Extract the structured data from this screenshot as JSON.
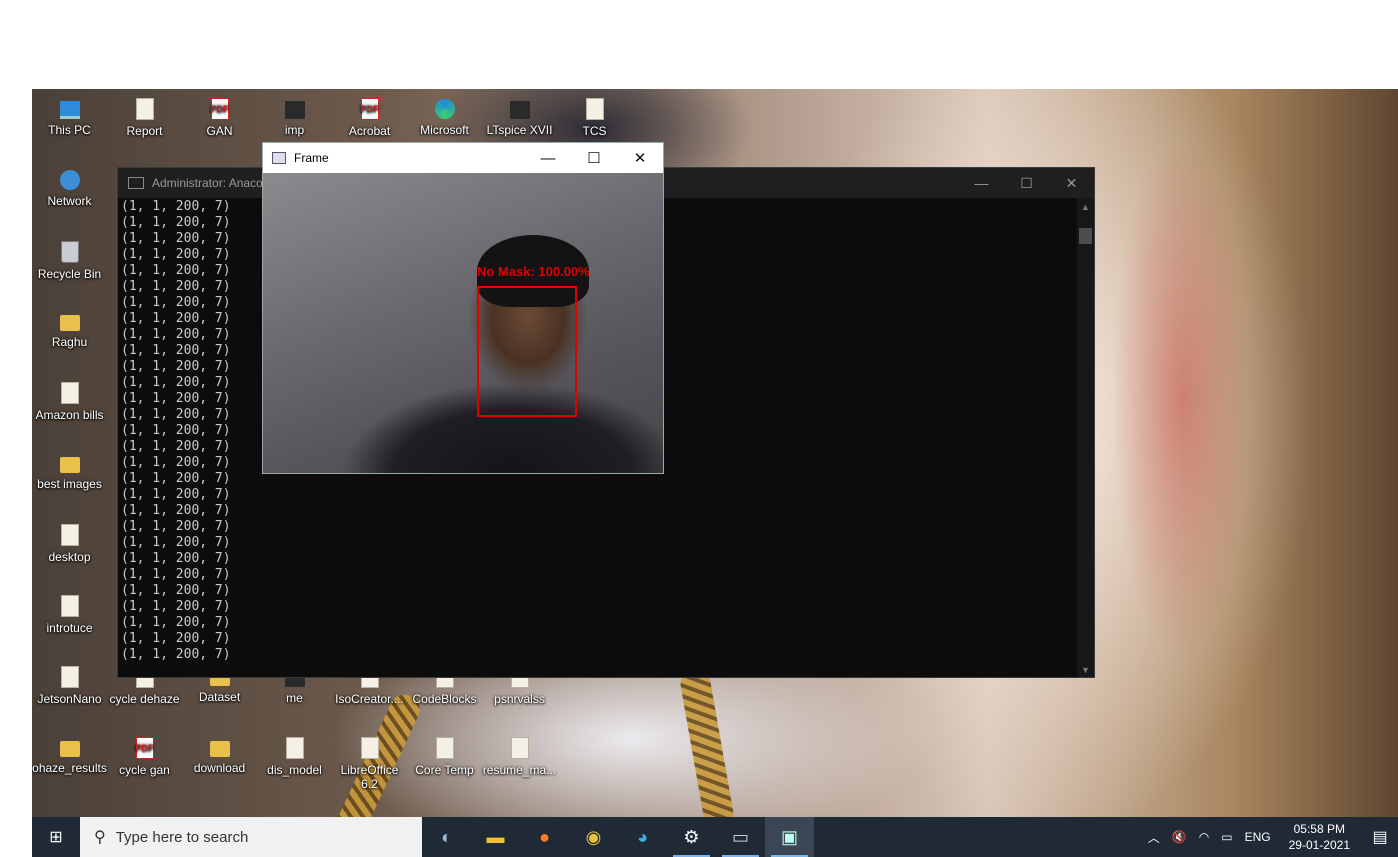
{
  "desktop": {
    "icons": [
      {
        "label": "This PC",
        "kind": "pc",
        "x": 0,
        "y": 0
      },
      {
        "label": "Report",
        "kind": "file"
      },
      {
        "label": "GAN",
        "kind": "pdf"
      },
      {
        "label": "imp",
        "kind": "dark"
      },
      {
        "label": "Acrobat",
        "kind": "pdf"
      },
      {
        "label": "Microsoft",
        "kind": "edge"
      },
      {
        "label": "LTspice XVII",
        "kind": "dark"
      },
      {
        "label": "TCS",
        "kind": "file"
      },
      {
        "label": "Network",
        "kind": "globe"
      },
      {
        "label": "Recycle Bin",
        "kind": "bin"
      },
      {
        "label": "Raghu",
        "kind": "folder"
      },
      {
        "label": "Amazon bills",
        "kind": "file"
      },
      {
        "label": "best images",
        "kind": "folder"
      },
      {
        "label": "desktop",
        "kind": "file"
      },
      {
        "label": "introtuce",
        "kind": "file"
      },
      {
        "label": "JetsonNano",
        "kind": "file"
      },
      {
        "label": "cycle dehaze",
        "kind": "file"
      },
      {
        "label": "Dataset",
        "kind": "folder"
      },
      {
        "label": "me",
        "kind": "dark"
      },
      {
        "label": "IsoCreator....",
        "kind": "file"
      },
      {
        "label": "CodeBlocks",
        "kind": "file"
      },
      {
        "label": "psnrvalss",
        "kind": "file"
      },
      {
        "label": "ohaze_results",
        "kind": "folder"
      },
      {
        "label": "cycle gan",
        "kind": "pdf"
      },
      {
        "label": "download",
        "kind": "folder"
      },
      {
        "label": "dis_model",
        "kind": "file"
      },
      {
        "label": "LibreOffice 6.2",
        "kind": "file"
      },
      {
        "label": "Core Temp",
        "kind": "file"
      },
      {
        "label": "resume_ma...",
        "kind": "file"
      }
    ]
  },
  "console": {
    "title": "Administrator: Anaco",
    "minimize": "—",
    "maximize": "☐",
    "close": "✕",
    "lines": [
      "(1, 1, 200, 7)",
      "(1, 1, 200, 7)",
      "(1, 1, 200, 7)",
      "(1, 1, 200, 7)",
      "(1, 1, 200, 7)",
      "(1, 1, 200, 7)",
      "(1, 1, 200, 7)",
      "(1, 1, 200, 7)",
      "(1, 1, 200, 7)",
      "(1, 1, 200, 7)",
      "(1, 1, 200, 7)",
      "(1, 1, 200, 7)",
      "(1, 1, 200, 7)",
      "(1, 1, 200, 7)",
      "(1, 1, 200, 7)",
      "(1, 1, 200, 7)",
      "(1, 1, 200, 7)",
      "(1, 1, 200, 7)",
      "(1, 1, 200, 7)",
      "(1, 1, 200, 7)",
      "(1, 1, 200, 7)",
      "(1, 1, 200, 7)",
      "(1, 1, 200, 7)",
      "(1, 1, 200, 7)",
      "(1, 1, 200, 7)",
      "(1, 1, 200, 7)",
      "(1, 1, 200, 7)",
      "(1, 1, 200, 7)",
      "(1, 1, 200, 7)"
    ]
  },
  "frame": {
    "title": "Frame",
    "minimize": "—",
    "maximize": "☐",
    "close": "✕",
    "detection_label": "No Mask: 100.00%",
    "box_color": "#e00000"
  },
  "taskbar": {
    "search_placeholder": "Type here to search",
    "apps": [
      "anaconda-icon",
      "file-explorer-icon",
      "firefox-icon",
      "chrome-icon",
      "edge-icon",
      "settings-icon",
      "terminal-icon",
      "frame-window-icon"
    ],
    "tray": {
      "language": "ENG",
      "time": "05:58 PM",
      "date": "29-01-2021"
    }
  }
}
